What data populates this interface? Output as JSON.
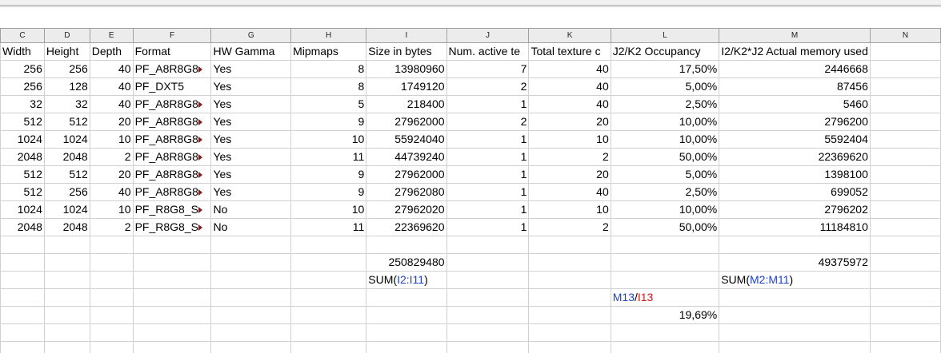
{
  "columns": [
    "C",
    "D",
    "E",
    "F",
    "G",
    "H",
    "I",
    "J",
    "K",
    "L",
    "M",
    "N"
  ],
  "header_row": [
    "Width",
    "Height",
    "Depth",
    "Format",
    "HW Gamma",
    "Mipmaps",
    "Size in bytes",
    "Num. active te",
    "Total texture c",
    "J2/K2 Occupancy",
    "I2/K2*J2 Actual memory used",
    ""
  ],
  "rows": [
    [
      "256",
      "256",
      "40",
      "PF_A8R8G8",
      "Yes",
      "8",
      "13980960",
      "7",
      "40",
      "17,50%",
      "2446668",
      ""
    ],
    [
      "256",
      "128",
      "40",
      "PF_DXT5",
      "Yes",
      "8",
      "1749120",
      "2",
      "40",
      "5,00%",
      "87456",
      ""
    ],
    [
      "32",
      "32",
      "40",
      "PF_A8R8G8",
      "Yes",
      "5",
      "218400",
      "1",
      "40",
      "2,50%",
      "5460",
      ""
    ],
    [
      "512",
      "512",
      "20",
      "PF_A8R8G8",
      "Yes",
      "9",
      "27962000",
      "2",
      "20",
      "10,00%",
      "2796200",
      ""
    ],
    [
      "1024",
      "1024",
      "10",
      "PF_A8R8G8",
      "Yes",
      "10",
      "55924040",
      "1",
      "10",
      "10,00%",
      "5592404",
      ""
    ],
    [
      "2048",
      "2048",
      "2",
      "PF_A8R8G8",
      "Yes",
      "11",
      "44739240",
      "1",
      "2",
      "50,00%",
      "22369620",
      ""
    ],
    [
      "512",
      "512",
      "20",
      "PF_A8R8G8",
      "Yes",
      "9",
      "27962000",
      "1",
      "20",
      "5,00%",
      "1398100",
      ""
    ],
    [
      "512",
      "256",
      "40",
      "PF_A8R8G8",
      "Yes",
      "9",
      "27962080",
      "1",
      "40",
      "2,50%",
      "699052",
      ""
    ],
    [
      "1024",
      "1024",
      "10",
      "PF_R8G8_S",
      "No",
      "10",
      "27962020",
      "1",
      "10",
      "10,00%",
      "2796202",
      ""
    ],
    [
      "2048",
      "2048",
      "2",
      "PF_R8G8_S",
      "No",
      "11",
      "22369620",
      "1",
      "2",
      "50,00%",
      "11184810",
      ""
    ]
  ],
  "overflow_rows": [
    0,
    2,
    3,
    4,
    5,
    6,
    7,
    8,
    9
  ],
  "totals": {
    "size_sum": "250829480",
    "memory_sum": "49375972",
    "size_formula_prefix": "SUM(",
    "size_formula_ref": "I2:I11",
    "size_formula_suffix": ")",
    "memory_formula_prefix": "SUM(",
    "memory_formula_ref": "M2:M11",
    "memory_formula_suffix": ")",
    "ratio_formula_a": "M13",
    "ratio_formula_sep": "/",
    "ratio_formula_b": "I13",
    "ratio_value": "19,69%"
  },
  "colors": {
    "ref_blue": "#1f3fcf",
    "ref_red": "#d21414"
  }
}
